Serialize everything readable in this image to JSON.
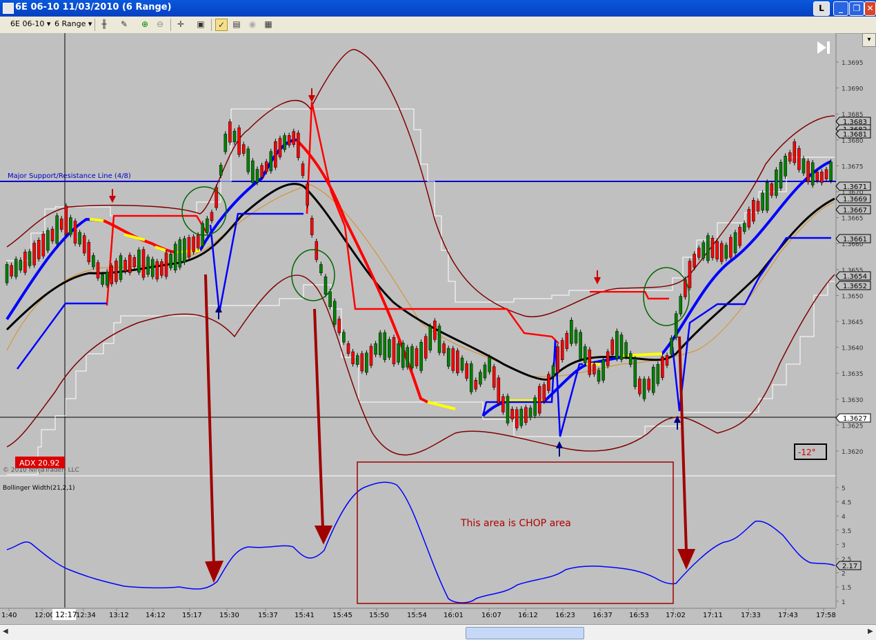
{
  "window": {
    "title": "6E 06-10  11/03/2010 (6 Range)",
    "buttons": {
      "minimize": "_",
      "restore": "❐",
      "close": "✕",
      "indicator": "L"
    }
  },
  "toolbar": {
    "instrument": "6E 06-10",
    "interval": "6 Range",
    "icons": [
      "candlestick-icon",
      "pencil-icon",
      "zoom-in-icon",
      "zoom-out-icon",
      "crosshair-icon",
      "properties-icon",
      "strategy-icon",
      "chart-icon",
      "globe-icon",
      "data-box-icon"
    ]
  },
  "chart": {
    "price_labels": [
      "1.3695",
      "1.3690",
      "1.3685",
      "1.3680",
      "1.3675",
      "1.3670",
      "1.3665",
      "1.3660",
      "1.3655",
      "1.3650",
      "1.3645",
      "1.3640",
      "1.3635",
      "1.3630",
      "1.3625",
      "1.3620"
    ],
    "badges": [
      {
        "text": "1.3683",
        "bg": "#c0c0c0"
      },
      {
        "text": "1.3682",
        "bg": "#c0c0c0"
      },
      {
        "text": "1.3681",
        "bg": "#c0c0c0"
      },
      {
        "text": "1.3671",
        "bg": "#c0c0c0"
      },
      {
        "text": "1.3669",
        "bg": "#c0c0c0"
      },
      {
        "text": "1.3667",
        "bg": "#c0c0c0"
      },
      {
        "text": "1.3661",
        "bg": "#c0c0c0"
      },
      {
        "text": "1.3654",
        "bg": "#c0c0c0"
      },
      {
        "text": "1.3652",
        "bg": "#c0c0c0"
      },
      {
        "text": "1.3627",
        "bg": "#ffffff"
      }
    ],
    "support_line_label": "Major Support/Resistance Line (4/8)",
    "adx_label": "ADX 20.92",
    "copyright": "© 2010 NinjaTrader, LLC",
    "angle_label": "-12°",
    "indicator_title": "Bollinger Width(21,2,1)",
    "indicator_labels": [
      "5",
      "4.5",
      "4",
      "3.5",
      "3",
      "2.5",
      "2",
      "1.5",
      "1"
    ],
    "indicator_badge": "2.17",
    "annotation": "This area is CHOP area",
    "time_labels": [
      "1:40",
      "12:00",
      "12:34",
      "13:12",
      "14:12",
      "15:17",
      "15:30",
      "15:37",
      "15:41",
      "15:45",
      "15:50",
      "15:54",
      "16:01",
      "16:07",
      "16:12",
      "16:23",
      "16:37",
      "16:53",
      "17:02",
      "17:11",
      "17:33",
      "17:43",
      "17:58"
    ],
    "crosshair_time": "12:17",
    "colors": {
      "background": "#c0c0c0",
      "support": "#0000cc",
      "band": "#800000",
      "sma": "#0000ff",
      "up": "#008000",
      "down": "#ff0000",
      "yellow": "#ffff00"
    }
  }
}
